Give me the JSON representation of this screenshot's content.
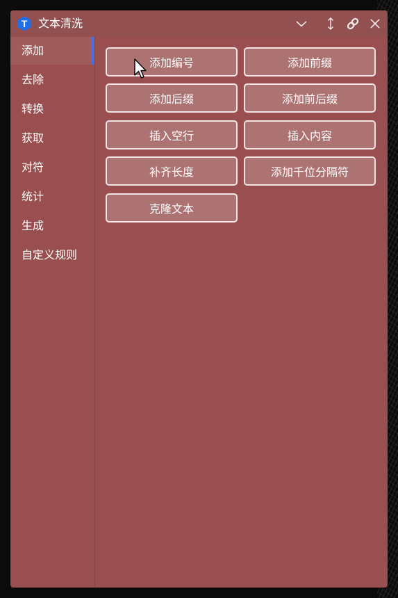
{
  "app": {
    "logo_letter": "T",
    "title": "文本清洗"
  },
  "titlebar": {
    "icons": [
      "chevron-down-icon",
      "resize-vertical-icon",
      "link-icon",
      "close-icon"
    ]
  },
  "sidebar": {
    "items": [
      {
        "label": "添加",
        "active": true
      },
      {
        "label": "去除"
      },
      {
        "label": "转换"
      },
      {
        "label": "获取"
      },
      {
        "label": "对符"
      },
      {
        "label": "统计"
      },
      {
        "label": "生成"
      },
      {
        "label": "自定义规则"
      }
    ]
  },
  "actions": [
    "添加编号",
    "添加前缀",
    "添加后缀",
    "添加前后缀",
    "插入空行",
    "插入内容",
    "补齐长度",
    "添加千位分隔符",
    "克隆文本"
  ],
  "colors": {
    "window": "#994f4f",
    "titlebar": "#935050",
    "accent": "#4a6fe0",
    "logo": "#1f6fe8"
  }
}
